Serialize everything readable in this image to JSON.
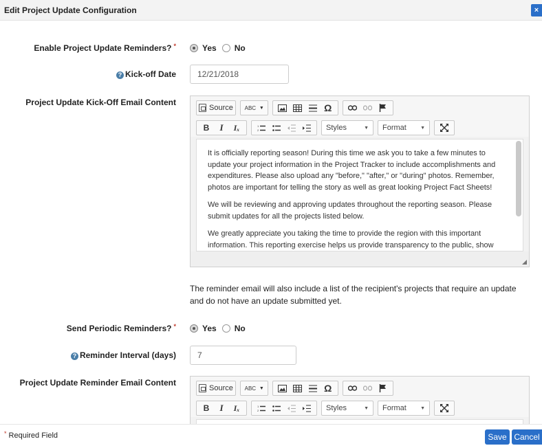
{
  "dialog": {
    "title": "Edit Project Update Configuration",
    "close_label": "×"
  },
  "fields": {
    "enable_reminders": {
      "label": "Enable Project Update Reminders?",
      "required_mark": "*",
      "options": [
        "Yes",
        "No"
      ],
      "selected": "Yes"
    },
    "kickoff_date": {
      "label": "Kick-off Date",
      "value": "12/21/2018"
    },
    "kickoff_email": {
      "label": "Project Update Kick-Off Email Content"
    },
    "send_periodic": {
      "label": "Send Periodic Reminders?",
      "required_mark": "*",
      "options": [
        "Yes",
        "No"
      ],
      "selected": "Yes"
    },
    "reminder_interval": {
      "label": "Reminder Interval (days)",
      "value": "7"
    },
    "reminder_email": {
      "label": "Project Update Reminder Email Content"
    }
  },
  "editor_toolbar": {
    "source_label": "Source",
    "spell_label": "ABC",
    "omega": "Ω",
    "bold": "B",
    "italic": "I",
    "clear_format": "Iₓ",
    "styles_label": "Styles",
    "format_label": "Format"
  },
  "kickoff_email_body": [
    "It is officially reporting season! During this time we ask you to take a few minutes to update your project information in the Project Tracker to include accomplishments and expenditures. Please also upload any \"before,\" \"after,\" or \"during\" photos. Remember, photos are important for telling the story as well as great looking Project Fact Sheets!",
    "We will be reviewing and approving updates throughout the reporting season. Please submit updates for all the projects listed below.",
    "We greatly appreciate you taking the time to provide the region with this important information. This reporting exercise helps us provide transparency to the public, show"
  ],
  "reminder_note": "The reminder email will also include a list of the recipient's projects that require an update and do not have an update submitted yet.",
  "footer": {
    "required_mark": "*",
    "required_text": "Required Field",
    "save_label": "Save",
    "cancel_label": "Cancel"
  },
  "colors": {
    "accent": "#2a6fc9",
    "required": "#c0392b"
  },
  "icons": [
    "close-icon",
    "help-icon",
    "source-icon",
    "spellcheck-icon",
    "image-icon",
    "table-icon",
    "horizontal-rule-icon",
    "special-char-icon",
    "link-icon",
    "unlink-icon",
    "anchor-flag-icon",
    "numbered-list-icon",
    "bullet-list-icon",
    "outdent-icon",
    "indent-icon",
    "maximize-icon",
    "resize-grip-icon"
  ]
}
